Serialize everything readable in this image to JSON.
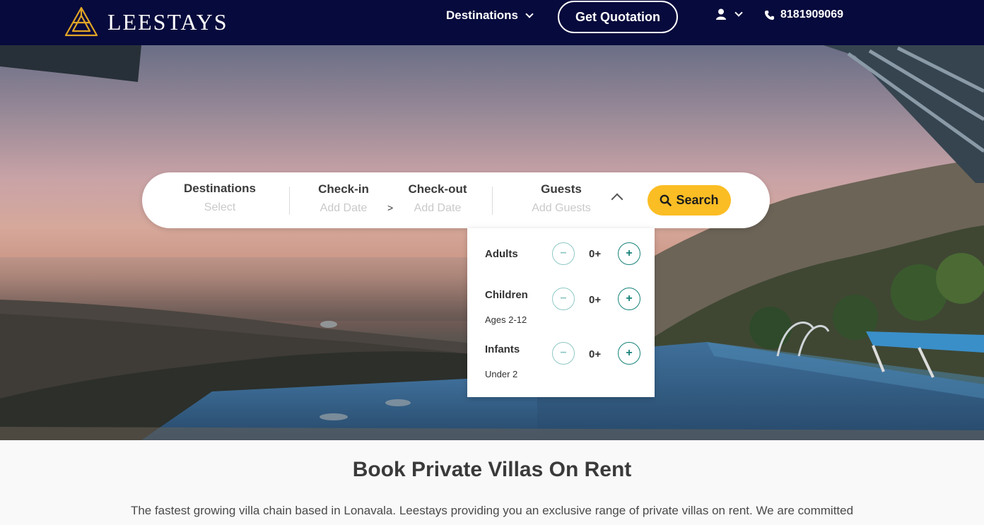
{
  "header": {
    "logo_text": "LEESTAYS",
    "nav_destinations": "Destinations",
    "quote_button": "Get Quotation",
    "phone": "8181909069"
  },
  "search": {
    "destinations_label": "Destinations",
    "destinations_placeholder": "Select",
    "checkin_label": "Check-in",
    "checkin_placeholder": "Add Date",
    "arrow": ">",
    "checkout_label": "Check-out",
    "checkout_placeholder": "Add Date",
    "guests_label": "Guests",
    "guests_placeholder": "Add Guests",
    "search_button": "Search"
  },
  "guests_panel": {
    "rows": [
      {
        "label": "Adults",
        "sub": "",
        "count": "0+",
        "minus": "−",
        "plus": "+"
      },
      {
        "label": "Children",
        "sub": "Ages 2-12",
        "count": "0+",
        "minus": "−",
        "plus": "+"
      },
      {
        "label": "Infants",
        "sub": "Under 2",
        "count": "0+",
        "minus": "−",
        "plus": "+"
      }
    ]
  },
  "main": {
    "title": "Book Private Villas On Rent",
    "paragraph": "The fastest growing villa chain based in Lonavala. Leestays providing you an exclusive range of private villas on rent. We are committed"
  },
  "colors": {
    "header_bg": "#070a3c",
    "accent_yellow": "#fbbd24",
    "logo_gold": "#e0a526",
    "teal": "#17827a"
  },
  "icons": {
    "logo": "triangle-logo-icon",
    "user": "user-icon",
    "phone": "phone-icon",
    "search": "search-icon"
  }
}
